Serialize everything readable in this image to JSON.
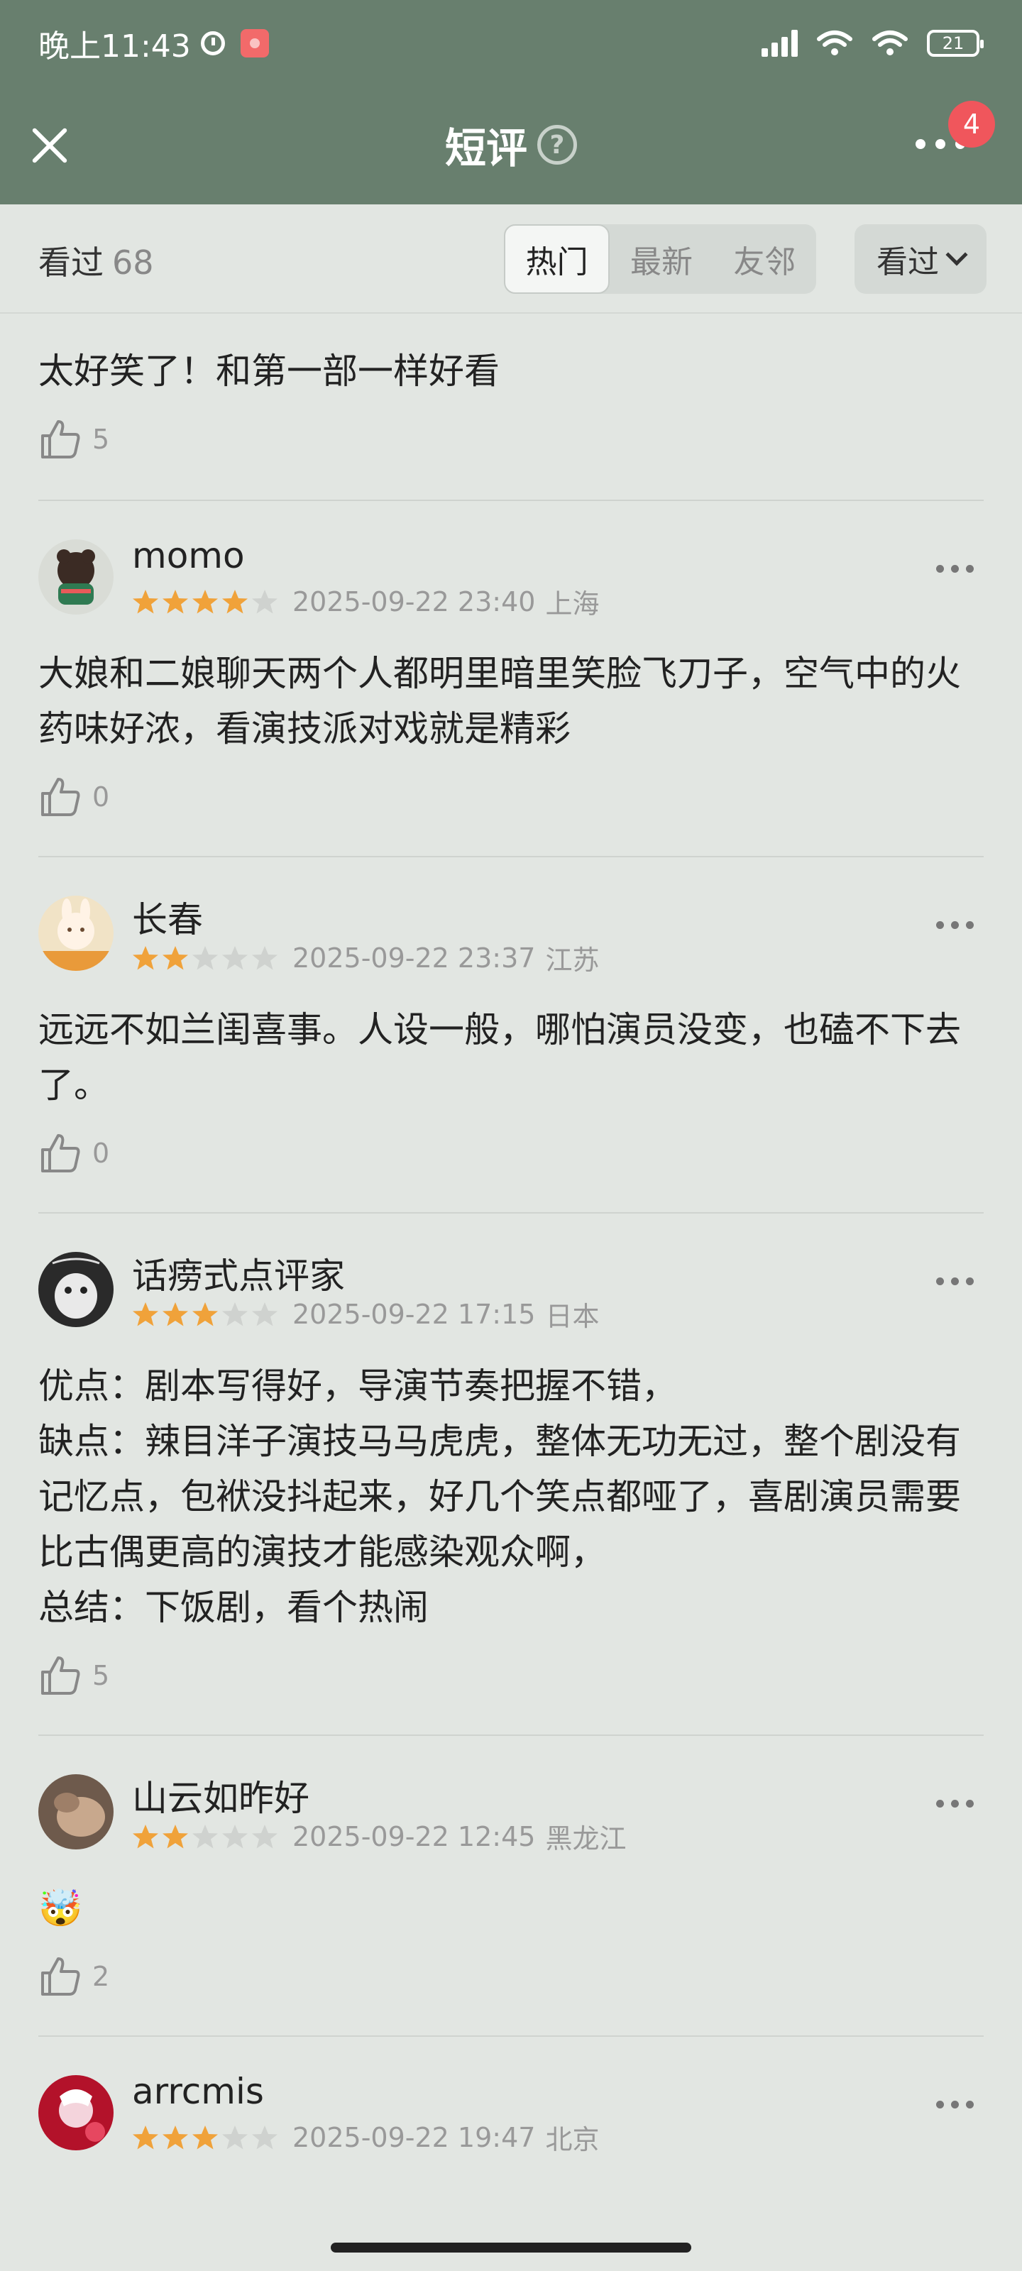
{
  "status_bar": {
    "time": "晚上11:43",
    "battery": "21"
  },
  "nav": {
    "title": "短评",
    "help_icon": "?",
    "badge": "4"
  },
  "filter": {
    "count_label": "看过",
    "count_value": "68",
    "tabs": [
      "热门",
      "最新",
      "友邻"
    ],
    "active_tab": "热门",
    "dropdown": "看过"
  },
  "colors": {
    "header_bg": "#687f6e",
    "badge": "#f0565c",
    "star_on": "#f0a23a",
    "star_off": "#cfd2cf"
  },
  "reviews": [
    {
      "user": "",
      "rating": 0,
      "date": "",
      "location": "",
      "content": "太好笑了！和第一部一样好看",
      "likes": "5"
    },
    {
      "user": "momo",
      "rating": 4,
      "date": "2025-09-22 23:40",
      "location": "上海",
      "content": "大娘和二娘聊天两个人都明里暗里笑脸飞刀子，空气中的火药味好浓，看演技派对戏就是精彩",
      "likes": "0"
    },
    {
      "user": "长春",
      "rating": 2,
      "date": "2025-09-22 23:37",
      "location": "江苏",
      "content": "远远不如兰闺喜事。人设一般，哪怕演员没变，也磕不下去了。",
      "likes": "0"
    },
    {
      "user": "话痨式点评家",
      "rating": 3,
      "date": "2025-09-22 17:15",
      "location": "日本",
      "content": "优点：剧本写得好，导演节奏把握不错，\n缺点：辣目洋子演技马马虎虎，整体无功无过，整个剧没有记忆点，包袱没抖起来，好几个笑点都哑了，喜剧演员需要比古偶更高的演技才能感染观众啊，\n总结：下饭剧，看个热闹",
      "likes": "5"
    },
    {
      "user": "山云如昨好",
      "rating": 2,
      "date": "2025-09-22 12:45",
      "location": "黑龙江",
      "content": "🤯",
      "likes": "2"
    },
    {
      "user": "arrcmis",
      "rating": 3,
      "date": "2025-09-22 19:47",
      "location": "北京",
      "content": "",
      "likes": ""
    }
  ]
}
